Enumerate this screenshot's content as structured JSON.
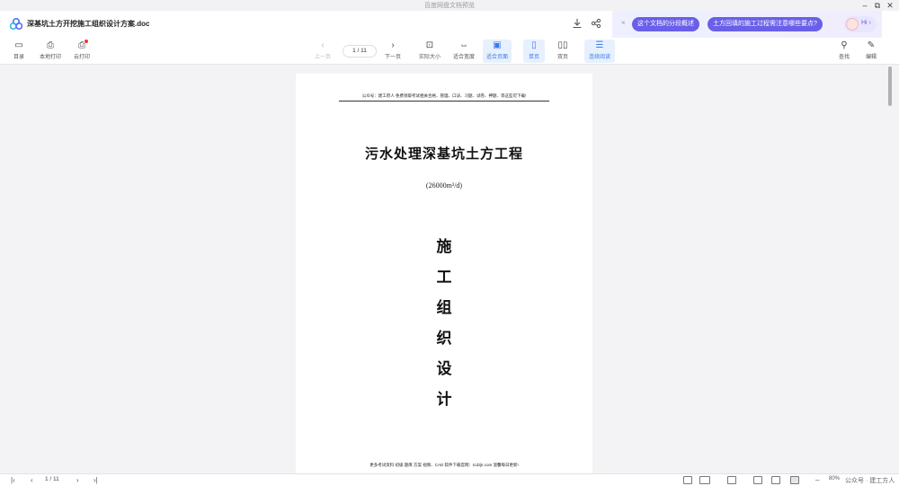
{
  "window": {
    "app_title": "百度网盘文档预览",
    "minimize": "–",
    "restore": "⧉",
    "close": "✕"
  },
  "document": {
    "filename": "深基坑土方开挖施工组织设计方案.doc"
  },
  "docbar": {
    "download_icon": "download-icon",
    "share_icon": "share-icon"
  },
  "ai": {
    "close": "×",
    "chips": [
      "这个文档的分段概述",
      "土方回填的施工过程需注意哪些要点?"
    ],
    "greeting": "Hi ›"
  },
  "toolbar": {
    "left": [
      {
        "icon": "▭",
        "label": "目录"
      },
      {
        "icon": "⎙",
        "label": "本地打印"
      },
      {
        "icon": "⎙",
        "label": "云打印"
      }
    ],
    "prev": {
      "icon": "‹",
      "label": "上一页"
    },
    "page_indicator": "1 / 11",
    "next": {
      "icon": "›",
      "label": "下一页"
    },
    "view": [
      {
        "icon": "⊡",
        "label": "实际大小"
      },
      {
        "icon": "⇔",
        "label": "适合宽度"
      },
      {
        "icon": "▣",
        "label": "适合页面"
      },
      {
        "icon": "▯",
        "label": "单页"
      },
      {
        "icon": "▯▯",
        "label": "双页"
      },
      {
        "icon": "☰",
        "label": "连续阅读"
      }
    ],
    "right": [
      {
        "icon": "⚲",
        "label": "查找"
      },
      {
        "icon": "✎",
        "label": "编辑"
      }
    ]
  },
  "page": {
    "header": "公众号：建工府人 免费领取考试相关合格、管理、口诀、习题、试卷、押题、等这些可下载!",
    "heading": "污水处理深基坑土方工程",
    "capacity": "(26000m³/d)",
    "vertical_title": [
      "施",
      "工",
      "组",
      "织",
      "设",
      "计"
    ],
    "footer": "更多考试资料 初级 题库 方案 视频、CAD 软件下载官网：tcdzjk.com 温馨每日更新!"
  },
  "status": {
    "first": "|‹",
    "prev": "‹",
    "page": "1 / 11",
    "next": "›",
    "last": "›|",
    "zoom_out": "–",
    "zoom": "80%",
    "watermark": "公众号 · 建工方人"
  },
  "colors": {
    "accent": "#3b7be8",
    "ai_chip": "#6a5fe8"
  }
}
